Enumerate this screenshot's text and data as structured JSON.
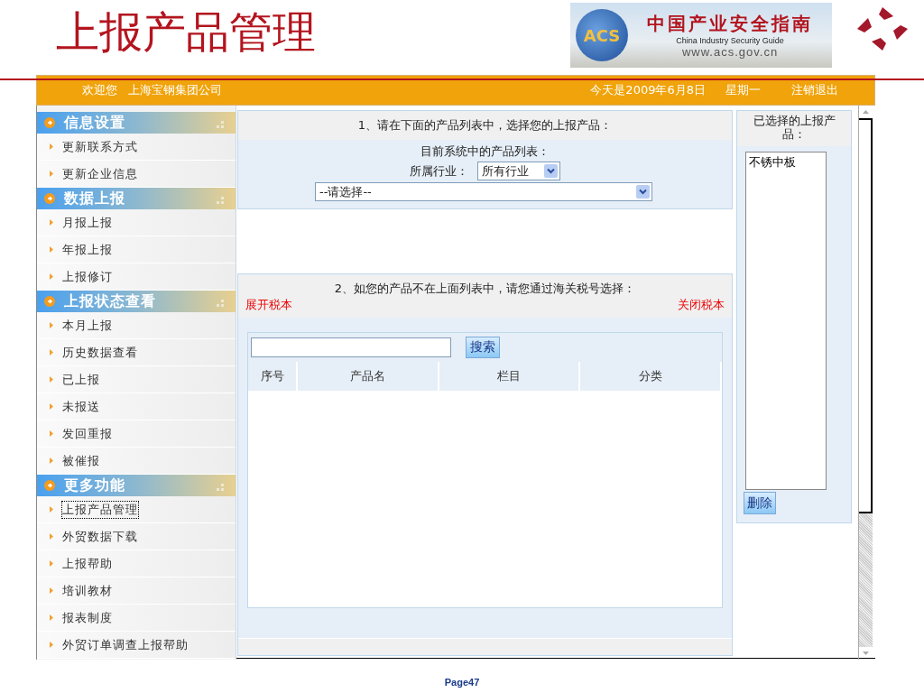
{
  "slide": {
    "title": "上报产品管理",
    "logo": {
      "badge": "ACS",
      "name": "中国产业安全指南",
      "english": "China Industry Security Guide",
      "url": "www.acs.gov.cn"
    },
    "footer": "Page47"
  },
  "top_bar": {
    "welcome": "欢迎您",
    "company": "上海宝钢集团公司",
    "date": "今天是2009年6月8日",
    "weekday": "星期一",
    "logout": "注销退出"
  },
  "sidebar": {
    "sections": [
      {
        "title": "信息设置",
        "items": [
          {
            "label": "更新联系方式",
            "selected": false
          },
          {
            "label": "更新企业信息",
            "selected": false
          }
        ]
      },
      {
        "title": "数据上报",
        "items": [
          {
            "label": "月报上报",
            "selected": false
          },
          {
            "label": "年报上报",
            "selected": false
          },
          {
            "label": "上报修订",
            "selected": false
          }
        ]
      },
      {
        "title": "上报状态查看",
        "items": [
          {
            "label": "本月上报",
            "selected": false
          },
          {
            "label": "历史数据查看",
            "selected": false
          },
          {
            "label": "已上报",
            "selected": false
          },
          {
            "label": "未报送",
            "selected": false
          },
          {
            "label": "发回重报",
            "selected": false
          },
          {
            "label": "被催报",
            "selected": false
          }
        ]
      },
      {
        "title": "更多功能",
        "items": [
          {
            "label": "上报产品管理",
            "selected": true
          },
          {
            "label": "外贸数据下载",
            "selected": false
          },
          {
            "label": "上报帮助",
            "selected": false
          },
          {
            "label": "培训教材",
            "selected": false
          },
          {
            "label": "报表制度",
            "selected": false
          },
          {
            "label": "外贸订单调查上报帮助",
            "selected": false
          }
        ]
      }
    ]
  },
  "product_list": {
    "heading": "1、请在下面的产品列表中，选择您的上报产品：",
    "subheading": "目前系统中的产品列表：",
    "industry_label": "所属行业：",
    "industry_value": "所有行业",
    "product_value": "--请选择--"
  },
  "tariff_search": {
    "heading": "2、如您的产品不在上面列表中，请您通过海关税号选择：",
    "expand_link": "展开税本",
    "collapse_link": "关闭税本",
    "search_button": "搜索",
    "columns": [
      "序号",
      "产品名",
      "栏目",
      "分类"
    ]
  },
  "selected_products": {
    "heading": "已选择的上报产品：",
    "items": [
      "不锈中板"
    ],
    "delete_button": "删除"
  }
}
